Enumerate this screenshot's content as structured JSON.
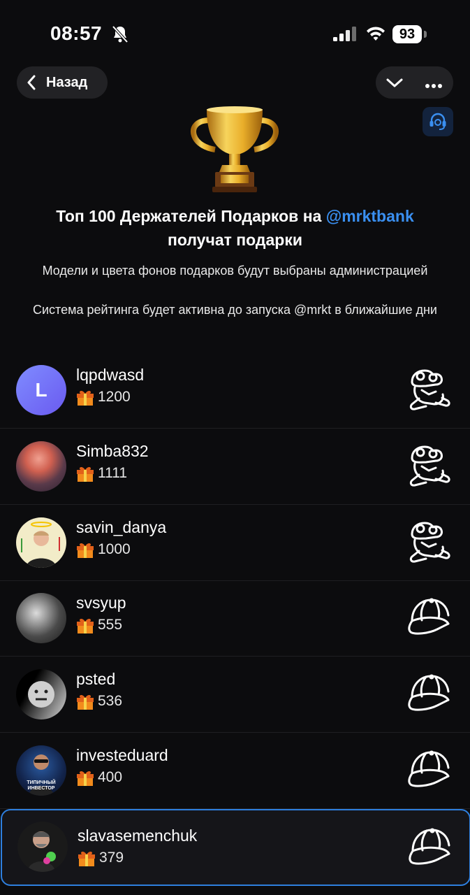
{
  "status_bar": {
    "time": "08:57",
    "battery": "93"
  },
  "nav": {
    "back_label": "Назад"
  },
  "header": {
    "title_part1": "Топ 100 Держателей Подарков на ",
    "title_mention": "@mrktbank",
    "title_part2": "получат подарки",
    "subtitle1": "Модели и цвета фонов подарков будут выбраны администрацией",
    "subtitle2": "Система рейтинга будет активна до запуска @mrkt в ближайшие дни"
  },
  "colors": {
    "accent": "#3a8ff0",
    "background": "#0c0c0e",
    "highlight_border": "#2e7fde"
  },
  "leaderboard": [
    {
      "name": "lqpdwasd",
      "count": "1200",
      "avatar_letter": "L",
      "item_icon": "frog-icon"
    },
    {
      "name": "Simba832",
      "count": "1111",
      "item_icon": "frog-icon"
    },
    {
      "name": "savin_danya",
      "count": "1000",
      "item_icon": "frog-icon"
    },
    {
      "name": "svsyup",
      "count": "555",
      "item_icon": "cap-icon"
    },
    {
      "name": "psted",
      "count": "536",
      "item_icon": "cap-icon"
    },
    {
      "name": "investeduard",
      "count": "400",
      "avatar_text": "ТИПИЧНЫЙ ИНВЕСТОР",
      "item_icon": "cap-icon"
    },
    {
      "name": "slavasemenchuk",
      "count": "379",
      "item_icon": "cap-icon"
    }
  ]
}
